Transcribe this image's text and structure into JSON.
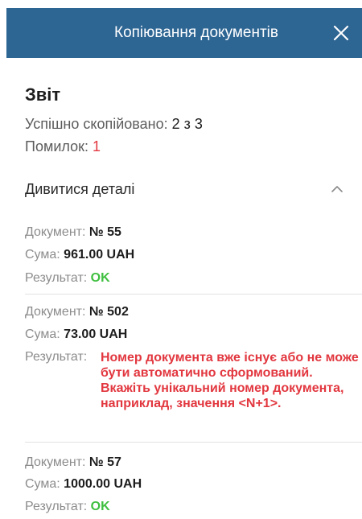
{
  "header": {
    "title": "Копіювання документів"
  },
  "report": {
    "title": "Звіт",
    "success_label": "Успішно скопійовано:",
    "success_value": "2 з 3",
    "errors_label": "Помилок:",
    "errors_value": "1"
  },
  "details": {
    "label": "Дивитися деталі",
    "expanded": true
  },
  "labels": {
    "document": "Документ:",
    "sum": "Сума:",
    "result": "Результат:"
  },
  "documents": [
    {
      "number": "№ 55",
      "sum": "961.00 UAH",
      "result": "OK",
      "status": "ok"
    },
    {
      "number": "№ 502",
      "sum": "73.00 UAH",
      "result": "Номер документа вже існує або не може бути автоматично сформований. Вкажіть унікальний номер документа, наприклад, значення <N+1>.",
      "status": "error"
    },
    {
      "number": "№ 57",
      "sum": "1000.00 UAH",
      "result": "OK",
      "status": "ok"
    }
  ],
  "colors": {
    "header_bg": "#2d6593",
    "ok": "#3fbf3f",
    "error": "#e2373f"
  }
}
